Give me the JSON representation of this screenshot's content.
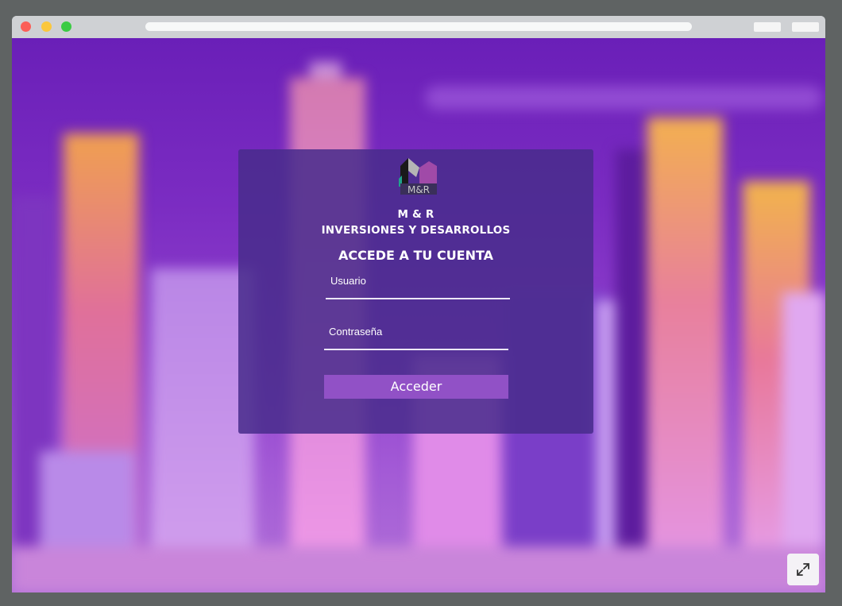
{
  "login": {
    "company_line1": "M & R",
    "company_line2": "INVERSIONES Y DESARROLLOS",
    "heading": "ACCEDE A TU CUENTA",
    "username_placeholder": "Usuario",
    "password_placeholder": "Contraseña",
    "submit_label": "Acceder"
  },
  "logo": {
    "text": "M&R"
  },
  "colors": {
    "card": "#482c8c",
    "button": "#9151c6",
    "background_top": "#6a1fb8",
    "background_bottom": "#b171d8"
  },
  "icons": {
    "expand": "expand-icon"
  }
}
